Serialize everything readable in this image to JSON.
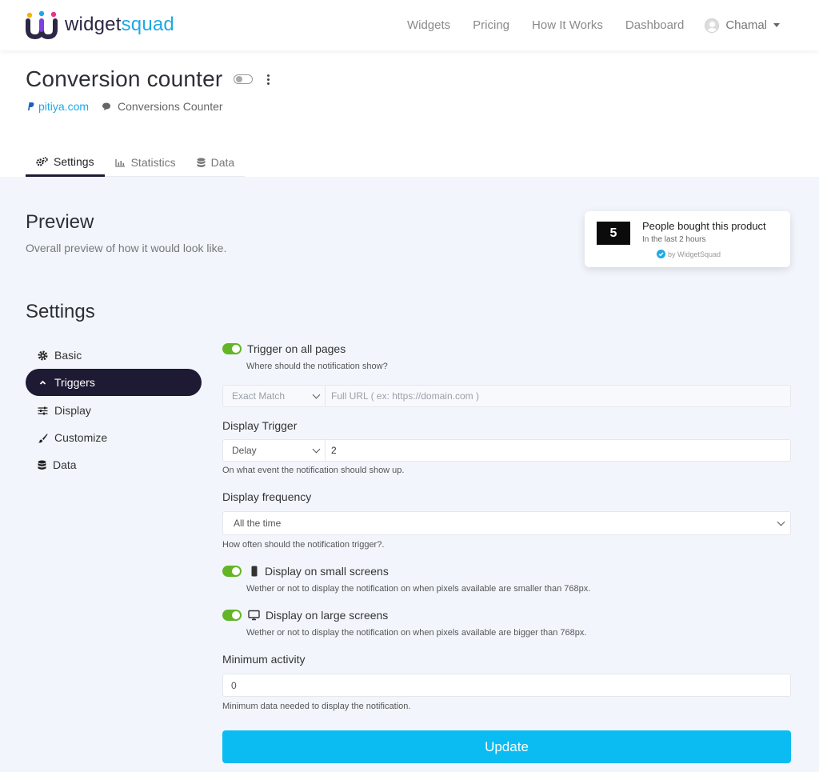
{
  "brand": {
    "name_part1": "widget",
    "name_part2": "squad",
    "colors": {
      "dark": "#2b2745",
      "blue": "#1da9e6",
      "pink": "#e8348c",
      "green": "#63b526",
      "accent_button": "#0bbcf2"
    }
  },
  "nav": {
    "links": [
      "Widgets",
      "Pricing",
      "How It Works",
      "Dashboard"
    ],
    "user_name": "Chamal"
  },
  "header": {
    "title": "Conversion counter",
    "site_link": "pitiya.com",
    "widget_type": "Conversions Counter",
    "tabs": [
      {
        "label": "Settings",
        "icon": "cogs-icon",
        "active": true
      },
      {
        "label": "Statistics",
        "icon": "bar-chart-icon",
        "active": false
      },
      {
        "label": "Data",
        "icon": "database-icon",
        "active": false
      }
    ]
  },
  "preview": {
    "heading": "Preview",
    "subheading": "Overall preview of how it would look like.",
    "card": {
      "count": "5",
      "title": "People bought this product",
      "subtitle": "In the last 2 hours",
      "branding": "by WidgetSquad"
    }
  },
  "settings": {
    "heading": "Settings",
    "menu": [
      {
        "label": "Basic",
        "icon": "gear-icon",
        "active": false
      },
      {
        "label": "Triggers",
        "icon": "chevron-up-icon",
        "active": true
      },
      {
        "label": "Display",
        "icon": "sliders-icon",
        "active": false
      },
      {
        "label": "Customize",
        "icon": "paintbrush-icon",
        "active": false
      },
      {
        "label": "Data",
        "icon": "database-icon",
        "active": false
      }
    ]
  },
  "form": {
    "trigger_all_pages": {
      "label": "Trigger on all pages",
      "help": "Where should the notification show?",
      "enabled": true
    },
    "url_match": {
      "select_value": "Exact Match",
      "placeholder": "Full URL ( ex: https://domain.com )"
    },
    "display_trigger": {
      "label": "Display Trigger",
      "select_value": "Delay",
      "value": "2",
      "help": "On what event the notification should show up."
    },
    "display_frequency": {
      "label": "Display frequency",
      "select_value": "All the time",
      "help": "How often should the notification trigger?."
    },
    "small_screens": {
      "label": "Display on small screens",
      "help": "Wether or not to display the notification on when pixels available are smaller than 768px.",
      "enabled": true
    },
    "large_screens": {
      "label": "Display on large screens",
      "help": "Wether or not to display the notification on when pixels available are bigger than 768px.",
      "enabled": true
    },
    "minimum_activity": {
      "label": "Minimum activity",
      "value": "0",
      "help": "Minimum data needed to display the notification."
    },
    "submit_label": "Update"
  }
}
